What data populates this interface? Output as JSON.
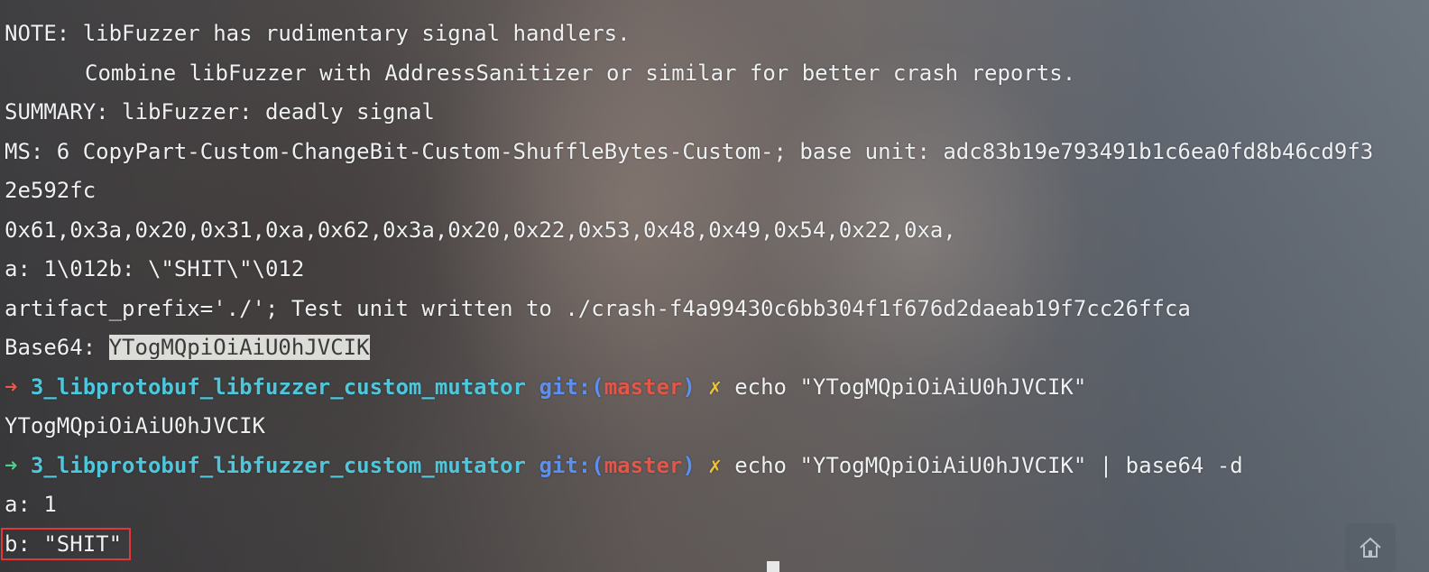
{
  "terminal": {
    "lines": {
      "note1": "NOTE: libFuzzer has rudimentary signal handlers.",
      "note2": "Combine libFuzzer with AddressSanitizer or similar for better crash reports.",
      "summary": "SUMMARY: libFuzzer: deadly signal",
      "ms": "MS: 6 CopyPart-Custom-ChangeBit-Custom-ShuffleBytes-Custom-; base unit: adc83b19e793491b1c6ea0fd8b46cd9f3",
      "ms_wrap": "2e592fc",
      "bytes": "0x61,0x3a,0x20,0x31,0xa,0x62,0x3a,0x20,0x22,0x53,0x48,0x49,0x54,0x22,0xa,",
      "escaped": "a: 1\\012b: \\\"SHIT\\\"\\012",
      "artifact": "artifact_prefix='./'; Test unit written to ./crash-f4a99430c6bb304f1f676d2daeab19f7cc26ffca",
      "base64_label": "Base64: ",
      "base64_value": "YTogMQpiOiAiU0hJVCIK",
      "echo_output": "YTogMQpiOiAiU0hJVCIK",
      "decoded_a": "a: 1",
      "decoded_b": "b: \"SHIT\""
    },
    "prompt1": {
      "arrow": "➜",
      "directory": "3_libprotobuf_libfuzzer_custom_mutator",
      "git_prefix": "git:(",
      "branch": "master",
      "git_suffix": ")",
      "dirty_mark": "✗",
      "command": "echo \"YTogMQpiOiAiU0hJVCIK\""
    },
    "prompt2": {
      "arrow": "➜",
      "directory": "3_libprotobuf_libfuzzer_custom_mutator",
      "git_prefix": "git:(",
      "branch": "master",
      "git_suffix": ")",
      "dirty_mark": "✗",
      "command": "echo \"YTogMQpiOiAiU0hJVCIK\" | base64 -d"
    }
  },
  "colors": {
    "prompt_arrow_error": "#e8574a",
    "prompt_arrow_ok": "#4fd08a",
    "directory": "#4ec7dc",
    "git": "#5b8ff0",
    "branch": "#e5564a",
    "dirty": "#f1c232",
    "highlight_box": "#e0373a"
  },
  "icons": {
    "home": "home-icon"
  }
}
